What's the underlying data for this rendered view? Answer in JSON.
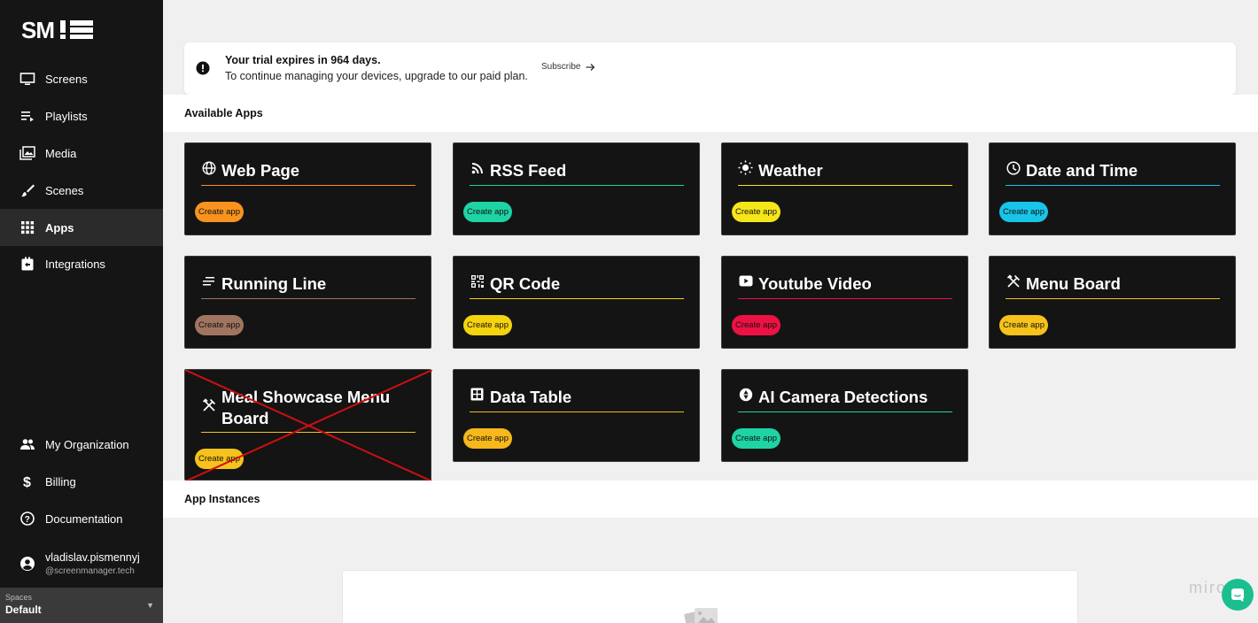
{
  "sidebar": {
    "logo_text": "SM!",
    "nav": [
      {
        "label": "Screens",
        "icon": "monitor-icon"
      },
      {
        "label": "Playlists",
        "icon": "playlist-icon"
      },
      {
        "label": "Media",
        "icon": "image-icon"
      },
      {
        "label": "Scenes",
        "icon": "brush-icon"
      },
      {
        "label": "Apps",
        "icon": "grid-icon",
        "active": true
      },
      {
        "label": "Integrations",
        "icon": "integration-icon"
      }
    ],
    "bottom_nav": [
      {
        "label": "My Organization",
        "icon": "people-icon"
      },
      {
        "label": "Billing",
        "icon": "dollar-icon"
      },
      {
        "label": "Documentation",
        "icon": "help-icon"
      }
    ],
    "user": {
      "name": "vladislav.pismennyj",
      "domain": "@screenmanager.tech"
    },
    "spaces": {
      "label": "Spaces",
      "value": "Default"
    }
  },
  "banner": {
    "title": "Your trial expires in 964 days.",
    "text": "To continue managing your devices, upgrade to our paid plan.",
    "link_label": "Subscribe"
  },
  "sections": {
    "available_apps": "Available Apps",
    "app_instances": "App Instances"
  },
  "apps": [
    {
      "title": "Web Page",
      "icon": "globe-icon",
      "button": "Create app",
      "color": "#f7931e"
    },
    {
      "title": "RSS Feed",
      "icon": "rss-icon",
      "button": "Create app",
      "color": "#1ed4a4"
    },
    {
      "title": "Weather",
      "icon": "sun-icon",
      "button": "Create app",
      "color": "#f5e61a"
    },
    {
      "title": "Date and Time",
      "icon": "clock-icon",
      "button": "Create app",
      "color": "#18c4e8"
    },
    {
      "title": "Running Line",
      "icon": "lines-icon",
      "button": "Create app",
      "color": "#a07560"
    },
    {
      "title": "QR Code",
      "icon": "qr-icon",
      "button": "Create app",
      "color": "#f5d30e"
    },
    {
      "title": "Youtube Video",
      "icon": "youtube-icon",
      "button": "Create app",
      "color": "#ee1144"
    },
    {
      "title": "Menu Board",
      "icon": "utensils-icon",
      "button": "Create app",
      "color": "#f6c21b"
    },
    {
      "title": "Meal Showcase Menu Board",
      "icon": "utensils-icon",
      "button": "Create app",
      "color": "#f6c21b",
      "crossed_out": true
    },
    {
      "title": "Data Table",
      "icon": "table-icon",
      "button": "Create app",
      "color": "#f6b81b"
    },
    {
      "title": "AI Camera Detections",
      "icon": "camera-aperture-icon",
      "button": "Create app",
      "color": "#1ed4a4"
    }
  ],
  "watermark": "miro",
  "colors": {
    "sidebar_bg": "#151515",
    "active_nav_bg": "#2b2b2b",
    "chat_button": "#1bbf8f"
  }
}
